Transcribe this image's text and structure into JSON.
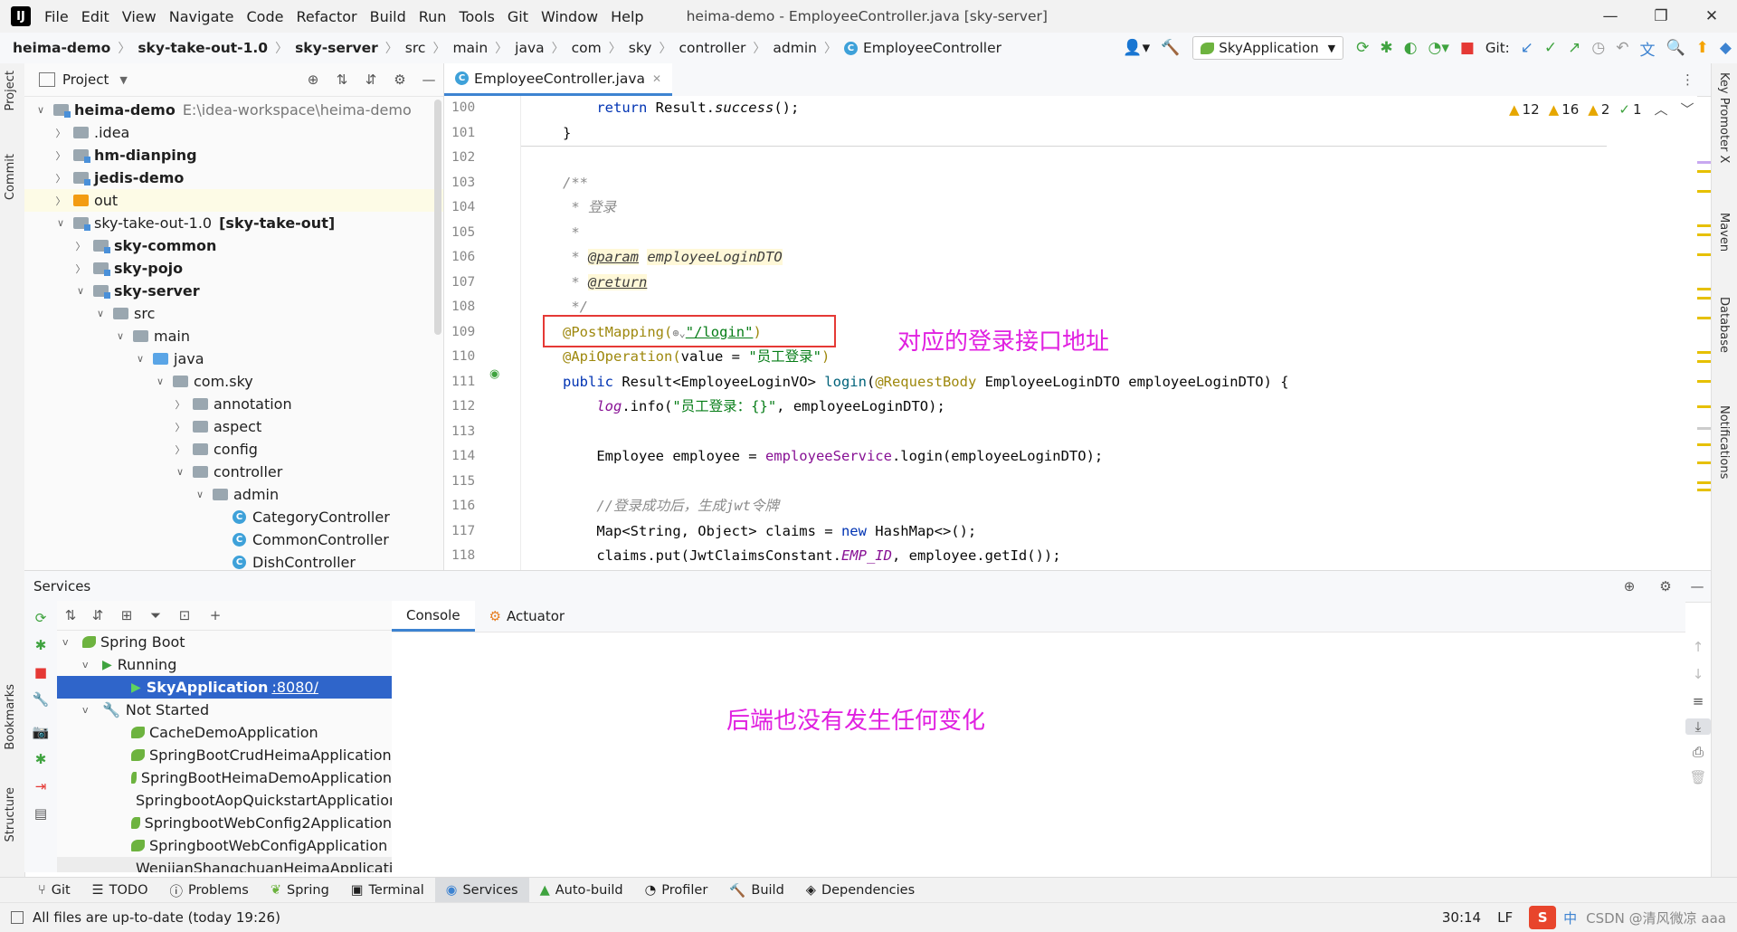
{
  "window": {
    "title": "heima-demo - EmployeeController.java [sky-server]",
    "menu": [
      "File",
      "Edit",
      "View",
      "Navigate",
      "Code",
      "Refactor",
      "Build",
      "Run",
      "Tools",
      "Git",
      "Window",
      "Help"
    ],
    "controls": [
      "—",
      "❐",
      "✕"
    ]
  },
  "breadcrumb": [
    "heima-demo",
    "sky-take-out-1.0",
    "sky-server",
    "src",
    "main",
    "java",
    "com",
    "sky",
    "controller",
    "admin",
    "EmployeeController"
  ],
  "toolbar": {
    "run_config": "SkyApplication",
    "git_label": "Git:"
  },
  "left_stripe": {
    "project": "Project",
    "commit": "Commit",
    "bookmarks": "Bookmarks",
    "structure": "Structure"
  },
  "project_panel": {
    "title": "Project",
    "tree": [
      {
        "label": "heima-demo",
        "extra": "E:\\idea-workspace\\heima-demo",
        "depth": 0,
        "arrow": "v",
        "icon": "module",
        "bold": true
      },
      {
        "label": ".idea",
        "depth": 1,
        "arrow": ">",
        "icon": "folder"
      },
      {
        "label": "hm-dianping",
        "depth": 1,
        "arrow": ">",
        "icon": "module",
        "bold": true
      },
      {
        "label": "jedis-demo",
        "depth": 1,
        "arrow": ">",
        "icon": "module",
        "bold": true
      },
      {
        "label": "out",
        "depth": 1,
        "arrow": ">",
        "icon": "folder-orange",
        "highlight": true
      },
      {
        "label": "sky-take-out-1.0",
        "extra": "[sky-take-out]",
        "depth": 1,
        "arrow": "v",
        "icon": "module",
        "extra_bold": true
      },
      {
        "label": "sky-common",
        "depth": 2,
        "arrow": ">",
        "icon": "module",
        "bold": true
      },
      {
        "label": "sky-pojo",
        "depth": 2,
        "arrow": ">",
        "icon": "module",
        "bold": true
      },
      {
        "label": "sky-server",
        "depth": 2,
        "arrow": "v",
        "icon": "module",
        "bold": true
      },
      {
        "label": "src",
        "depth": 3,
        "arrow": "v",
        "icon": "folder"
      },
      {
        "label": "main",
        "depth": 4,
        "arrow": "v",
        "icon": "folder"
      },
      {
        "label": "java",
        "depth": 5,
        "arrow": "v",
        "icon": "folder-blue"
      },
      {
        "label": "com.sky",
        "depth": 6,
        "arrow": "v",
        "icon": "folder"
      },
      {
        "label": "annotation",
        "depth": 7,
        "arrow": ">",
        "icon": "folder"
      },
      {
        "label": "aspect",
        "depth": 7,
        "arrow": ">",
        "icon": "folder"
      },
      {
        "label": "config",
        "depth": 7,
        "arrow": ">",
        "icon": "folder"
      },
      {
        "label": "controller",
        "depth": 7,
        "arrow": "v",
        "icon": "folder"
      },
      {
        "label": "admin",
        "depth": 8,
        "arrow": "v",
        "icon": "folder"
      },
      {
        "label": "CategoryController",
        "depth": 9,
        "arrow": "",
        "icon": "class"
      },
      {
        "label": "CommonController",
        "depth": 9,
        "arrow": "",
        "icon": "class"
      },
      {
        "label": "DishController",
        "depth": 9,
        "arrow": "",
        "icon": "class"
      }
    ]
  },
  "editor": {
    "tab": "EmployeeController.java",
    "line_numbers": [
      "100",
      "101",
      "102",
      "103",
      "104",
      "105",
      "106",
      "107",
      "108",
      "109",
      "110",
      "111",
      "112",
      "113",
      "114",
      "115",
      "116",
      "117",
      "118"
    ],
    "inspections": {
      "warn1": "12",
      "warn2": "16",
      "warn3": "2",
      "ok": "1"
    },
    "code": {
      "l100_kw": "return",
      "l100_rest": " Result.",
      "l100_m": "success",
      "l100_end": "();",
      "l101": "}",
      "l103": "/**",
      "l104": " * 登录",
      "l105": " *",
      "l106_a": " * ",
      "l106_tag": "@param",
      "l106_p": "employeeLoginDTO",
      "l107_a": " * ",
      "l107_tag": "@return",
      "l108": " */",
      "l109_a": "@PostMapping(",
      "l109_b": "\"/login\"",
      "l109_c": ")",
      "l110_a": "@ApiOperation(",
      "l110_b": "value = ",
      "l110_c": "\"员工登录\"",
      "l110_d": ")",
      "l111_kw": "public",
      "l111_a": " Result<EmployeeLoginVO> ",
      "l111_m": "login",
      "l111_b": "(",
      "l111_ann": "@RequestBody",
      "l111_c": " EmployeeLoginDTO employeeLoginDTO) {",
      "l112_f": "log",
      "l112_a": ".info(",
      "l112_s": "\"员工登录：{}\"",
      "l112_b": ", employeeLoginDTO);",
      "l114_a": "Employee employee = ",
      "l114_f": "employeeService",
      "l114_b": ".login(employeeLoginDTO);",
      "l116": "//登录成功后，生成jwt令牌",
      "l117_a": "Map<String, Object> claims = ",
      "l117_kw": "new",
      "l117_b": " HashMap<>();",
      "l118_a": "claims.put(JwtClaimsConstant.",
      "l118_f": "EMP_ID",
      "l118_b": ", employee.getId());"
    },
    "annotation_note": "对应的登录接口地址"
  },
  "right_stripe": [
    "Key Promoter X",
    "Maven",
    "Database",
    "Notifications"
  ],
  "services": {
    "title": "Services",
    "tree": {
      "spring_boot": "Spring Boot",
      "running": "Running",
      "selected_app": "SkyApplication",
      "selected_port": ":8080/",
      "not_started": "Not Started",
      "apps": [
        "CacheDemoApplication",
        "SpringBootCrudHeimaApplication",
        "SpringBootHeimaDemoApplication",
        "SpringbootAopQuickstartApplication",
        "SpringbootWebConfig2Application",
        "SpringbootWebConfigApplication",
        "WenjianShangchuanHeimaApplication"
      ]
    },
    "tabs": [
      "Console",
      "Actuator"
    ],
    "console_note": "后端也没有发生任何变化"
  },
  "bottom_tabs": [
    "Git",
    "TODO",
    "Problems",
    "Spring",
    "Terminal",
    "Services",
    "Auto-build",
    "Profiler",
    "Build",
    "Dependencies"
  ],
  "active_bottom_tab": "Services",
  "status": {
    "message": "All files are up-to-date (today 19:26)",
    "position": "30:14",
    "line_sep": "LF",
    "watermark": "CSDN @清风微凉 aaa"
  }
}
